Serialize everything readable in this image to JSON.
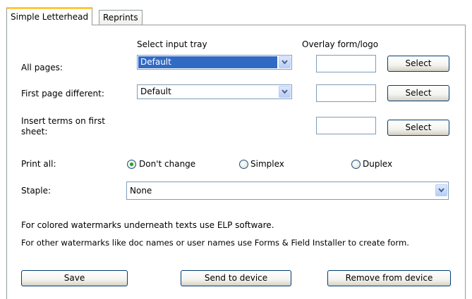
{
  "tabs": [
    {
      "label": "Simple Letterhead",
      "active": true
    },
    {
      "label": "Reprints",
      "active": false
    }
  ],
  "headers": {
    "input_tray": "Select input tray",
    "overlay": "Overlay form/logo"
  },
  "rows": {
    "all_pages": {
      "label": "All pages:",
      "tray_value": "Default",
      "select_label": "Select"
    },
    "first_page": {
      "label": "First page different:",
      "tray_value": "Default",
      "select_label": "Select"
    },
    "insert_terms": {
      "label_line1": "Insert terms on first",
      "label_line2": "sheet:",
      "select_label": "Select"
    }
  },
  "print_all": {
    "label": "Print all:",
    "options": [
      "Don't change",
      "Simplex",
      "Duplex"
    ],
    "selected": "Don't change"
  },
  "staple": {
    "label": "Staple:",
    "value": "None"
  },
  "notes": [
    "For colored watermarks underneath texts use ELP software.",
    "For other watermarks like doc names or user names use Forms & Field Installer to create form."
  ],
  "buttons": {
    "save": "Save",
    "send": "Send to device",
    "remove": "Remove from device"
  },
  "colors": {
    "selection": "#316ac5",
    "tab_highlight": "#ffc83c",
    "radio_dot": "#21a121"
  }
}
